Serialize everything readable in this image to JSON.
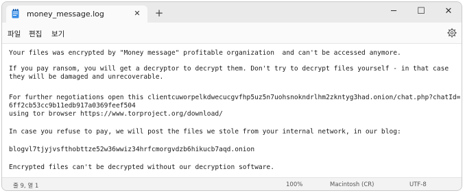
{
  "tab": {
    "title": "money_message.log",
    "close_glyph": "✕",
    "icon": "notepad-file-icon"
  },
  "new_tab_glyph": "+",
  "window_controls": {
    "minimize": "─",
    "maximize": "☐",
    "close": "✕"
  },
  "menu": {
    "file": "파일",
    "edit": "편집",
    "view": "보기"
  },
  "settings_icon": "gear-icon",
  "content": {
    "lines": [
      "Your files was encrypted by \"Money message\" profitable organization  and can't be accessed anymore.",
      "If you pay ransom, you will get a decryptor to decrypt them. Don't try to decrypt files yourself - in that case",
      "they will be damaged and unrecoverable.",
      "For further negotiations open this clientcuworpelkdwecucgvfhp5uz5n7uohsnokndrlhm2zkntyg3had.onion/chat.php?chatId=",
      "6ff2cb53cc9b11edb917a0369feef504",
      "using tor browser https://www.torproject.org/download/",
      "In case you refuse to pay, we will post the files we stole from your internal network, in our blog:",
      "blogvl7tjyjvsfthobttze52w36wwiz34hrfcmorgvdzb6hikucb7aqd.onion",
      "Encrypted files can't be decrypted without our decryption software."
    ]
  },
  "status": {
    "position": "줄 9, 열 1",
    "zoom": "100%",
    "line_ending": "Macintosh (CR)",
    "encoding": "UTF-8"
  },
  "colors": {
    "accent": "#1f7bd6",
    "background": "#ffffff",
    "chrome": "#f3f3f3"
  }
}
